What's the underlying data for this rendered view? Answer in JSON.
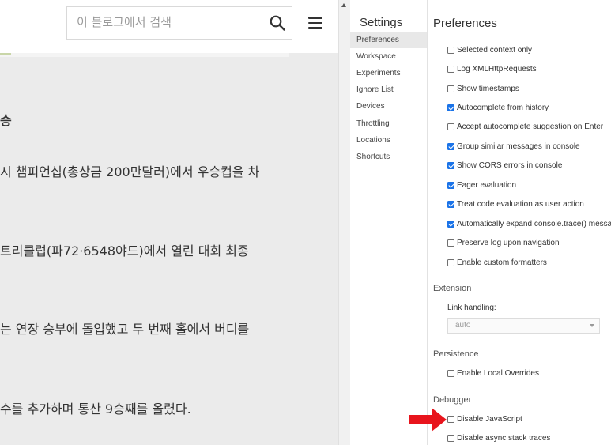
{
  "blog": {
    "search_placeholder": "이 블로그에서 검색",
    "heading": "승",
    "lines": [
      "시 챔피언십(총상금 200만달러)에서 우승컵을 차",
      "트리클럽(파72·6548야드)에서 열린 대회 최종",
      "는 연장 승부에 돌입했고 두 번째 홀에서 버디를",
      "수를 추가하며 통산 9승째를 올렸다."
    ]
  },
  "settings": {
    "title": "Settings",
    "nav": [
      "Preferences",
      "Workspace",
      "Experiments",
      "Ignore List",
      "Devices",
      "Throttling",
      "Locations",
      "Shortcuts"
    ],
    "active_nav": "Preferences",
    "panel_title": "Preferences",
    "console_options": [
      {
        "label": "Selected context only",
        "checked": false
      },
      {
        "label": "Log XMLHttpRequests",
        "checked": false
      },
      {
        "label": "Show timestamps",
        "checked": false
      },
      {
        "label": "Autocomplete from history",
        "checked": true
      },
      {
        "label": "Accept autocomplete suggestion on Enter",
        "checked": false
      },
      {
        "label": "Group similar messages in console",
        "checked": true
      },
      {
        "label": "Show CORS errors in console",
        "checked": true
      },
      {
        "label": "Eager evaluation",
        "checked": true
      },
      {
        "label": "Treat code evaluation as user action",
        "checked": true
      },
      {
        "label": "Automatically expand console.trace() messa",
        "checked": true
      },
      {
        "label": "Preserve log upon navigation",
        "checked": false
      },
      {
        "label": "Enable custom formatters",
        "checked": false
      }
    ],
    "extension": {
      "title": "Extension",
      "link_handling_label": "Link handling:",
      "link_handling_value": "auto"
    },
    "persistence": {
      "title": "Persistence",
      "options": [
        {
          "label": "Enable Local Overrides",
          "checked": false
        }
      ]
    },
    "debugger": {
      "title": "Debugger",
      "options": [
        {
          "label": "Disable JavaScript",
          "checked": false
        },
        {
          "label": "Disable async stack traces",
          "checked": false
        }
      ]
    }
  },
  "colors": {
    "checkbox_checked": "#1a73e8",
    "annotation_arrow": "#e8141c"
  },
  "icons": [
    "search-icon",
    "menu-icon",
    "red-arrow-annotation"
  ]
}
